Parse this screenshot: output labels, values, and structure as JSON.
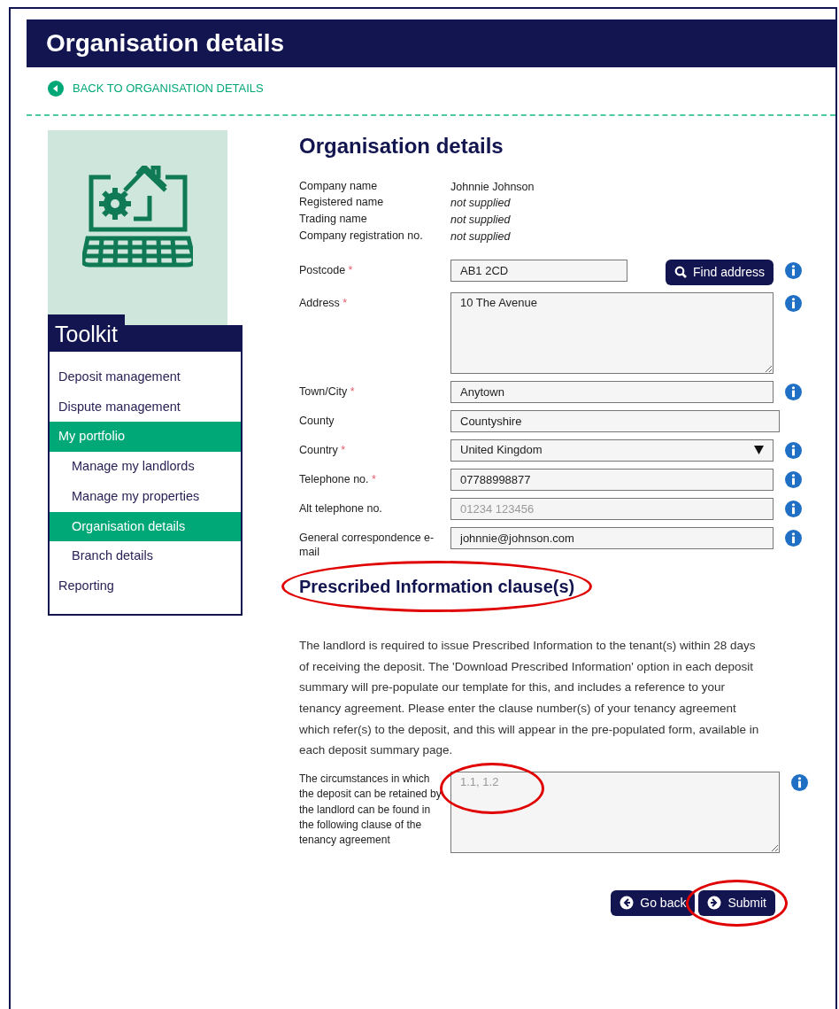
{
  "page_title": "Organisation details",
  "back_link": "BACK TO ORGANISATION DETAILS",
  "sidebar": {
    "title": "Toolkit",
    "items": [
      {
        "label": "Deposit management",
        "selected": false
      },
      {
        "label": "Dispute management",
        "selected": false
      },
      {
        "label": "My portfolio",
        "selected": true,
        "children": [
          {
            "label": "Manage my landlords",
            "selected": false
          },
          {
            "label": "Manage my properties",
            "selected": false
          },
          {
            "label": "Organisation details",
            "selected": true
          },
          {
            "label": "Branch details",
            "selected": false
          }
        ]
      },
      {
        "label": "Reporting",
        "selected": false
      }
    ]
  },
  "heading": "Organisation details",
  "details": [
    {
      "label": "Company name",
      "value": "Johnnie Johnson",
      "supplied": true
    },
    {
      "label": "Registered name",
      "value": "not supplied",
      "supplied": false
    },
    {
      "label": "Trading name",
      "value": "not supplied",
      "supplied": false
    },
    {
      "label": "Company registration no.",
      "value": "not supplied",
      "supplied": false
    }
  ],
  "fields": [
    {
      "kind": "postcode",
      "label": "Postcode",
      "required_mark": "*",
      "value": "AB1 2CD",
      "button": "Find address",
      "info": true
    },
    {
      "kind": "textarea",
      "label": "Address",
      "required_mark": "*",
      "value": "10 The Avenue",
      "info": true
    },
    {
      "kind": "text",
      "label": "Town/City",
      "required_mark": "*",
      "value": "Anytown",
      "info": true
    },
    {
      "kind": "text",
      "label": "County",
      "value": "Countyshire",
      "info": false
    },
    {
      "kind": "select",
      "label": "Country",
      "required_mark": "*",
      "value": "United Kingdom",
      "info": true
    },
    {
      "kind": "text",
      "label": "Telephone no.",
      "required_mark": "*",
      "value": "07788998877",
      "info": true
    },
    {
      "kind": "text",
      "label": "Alt telephone no.",
      "placeholder": "01234 123456",
      "info": true
    },
    {
      "kind": "text",
      "label": "General correspondence e-mail",
      "value": "johnnie@johnson.com",
      "info": true
    }
  ],
  "clause_section": {
    "heading": "Prescribed Information clause(s)",
    "heading_highlighted": true,
    "text": "The landlord is required to issue Prescribed Information to the tenant(s) within 28 days of receiving the deposit. The 'Download Prescribed Information' option in each deposit summary will pre-populate our template for this, and includes a reference to your tenancy agreement. Please enter the clause number(s) of your tenancy agreement which refer(s) to the deposit, and this will appear in the pre-populated form, available in each deposit summary page.",
    "field_label": "The circumstances in which the deposit can be retained by the landlord can be found in the following clause of the tenancy agreement",
    "placeholder": "1.1, 1.2",
    "field_highlighted": true,
    "info": true
  },
  "buttons": [
    {
      "label": "Go back",
      "kind": "back",
      "highlighted": false
    },
    {
      "label": "Submit",
      "kind": "forward",
      "highlighted": true
    }
  ]
}
